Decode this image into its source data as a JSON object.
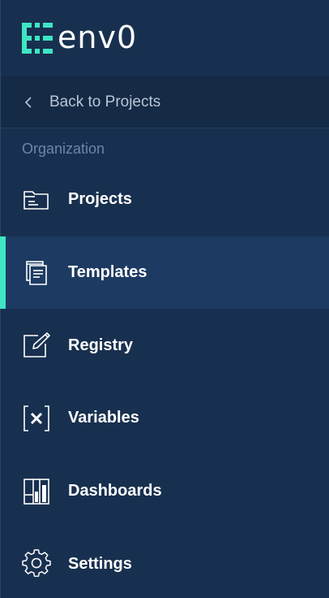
{
  "brand": {
    "name": "env0",
    "accent_color": "#3ee6c4"
  },
  "back_link": {
    "label": "Back to Projects",
    "icon": "chevron-left-icon"
  },
  "section": {
    "label": "Organization"
  },
  "nav": {
    "active": "Templates",
    "items": [
      {
        "label": "Projects",
        "icon": "folder-icon"
      },
      {
        "label": "Templates",
        "icon": "templates-icon"
      },
      {
        "label": "Registry",
        "icon": "edit-square-icon"
      },
      {
        "label": "Variables",
        "icon": "variables-icon"
      },
      {
        "label": "Dashboards",
        "icon": "dashboard-icon"
      },
      {
        "label": "Settings",
        "icon": "gear-icon"
      }
    ]
  }
}
